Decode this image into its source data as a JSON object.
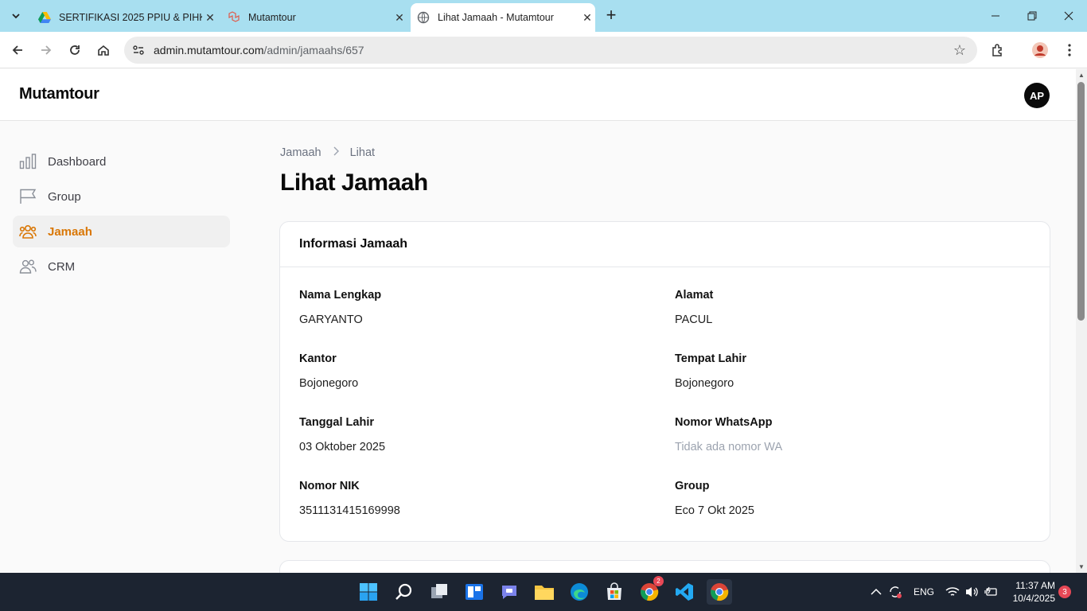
{
  "browser": {
    "tabs": [
      {
        "title": "SERTIFIKASI 2025 PPIU & PIHK",
        "icon": "google-drive-icon"
      },
      {
        "title": "Mutamtour",
        "icon": "laravel-icon"
      },
      {
        "title": "Lihat Jamaah - Mutamtour",
        "icon": "globe-icon"
      }
    ],
    "url_host": "admin.mutamtour.com",
    "url_path": "/admin/jamaahs/657"
  },
  "app": {
    "brand": "Mutamtour",
    "avatar_initials": "AP"
  },
  "sidebar": {
    "items": [
      {
        "label": "Dashboard",
        "icon": "bar-chart-icon"
      },
      {
        "label": "Group",
        "icon": "flag-icon"
      },
      {
        "label": "Jamaah",
        "icon": "users-icon",
        "active": true
      },
      {
        "label": "CRM",
        "icon": "user-group-icon"
      }
    ]
  },
  "breadcrumb": {
    "parent": "Jamaah",
    "current": "Lihat"
  },
  "page_title": "Lihat Jamaah",
  "card": {
    "title": "Informasi Jamaah",
    "fields": [
      {
        "label": "Nama Lengkap",
        "value": "GARYANTO"
      },
      {
        "label": "Alamat",
        "value": "PACUL"
      },
      {
        "label": "Kantor",
        "value": "Bojonegoro"
      },
      {
        "label": "Tempat Lahir",
        "value": "Bojonegoro"
      },
      {
        "label": "Tanggal Lahir",
        "value": "03 Oktober 2025"
      },
      {
        "label": "Nomor WhatsApp",
        "value": "Tidak ada nomor WA"
      },
      {
        "label": "Nomor NIK",
        "value": "3511131415169998"
      },
      {
        "label": "Group",
        "value": "Eco 7 Okt 2025"
      }
    ]
  },
  "taskbar": {
    "language": "ENG",
    "time": "11:37 AM",
    "date": "10/4/2025",
    "notifications": "3",
    "chrome_badge": "2"
  },
  "colors": {
    "accent": "#d97706",
    "tabbar": "#a8dff0",
    "taskbar": "#1c2431"
  }
}
